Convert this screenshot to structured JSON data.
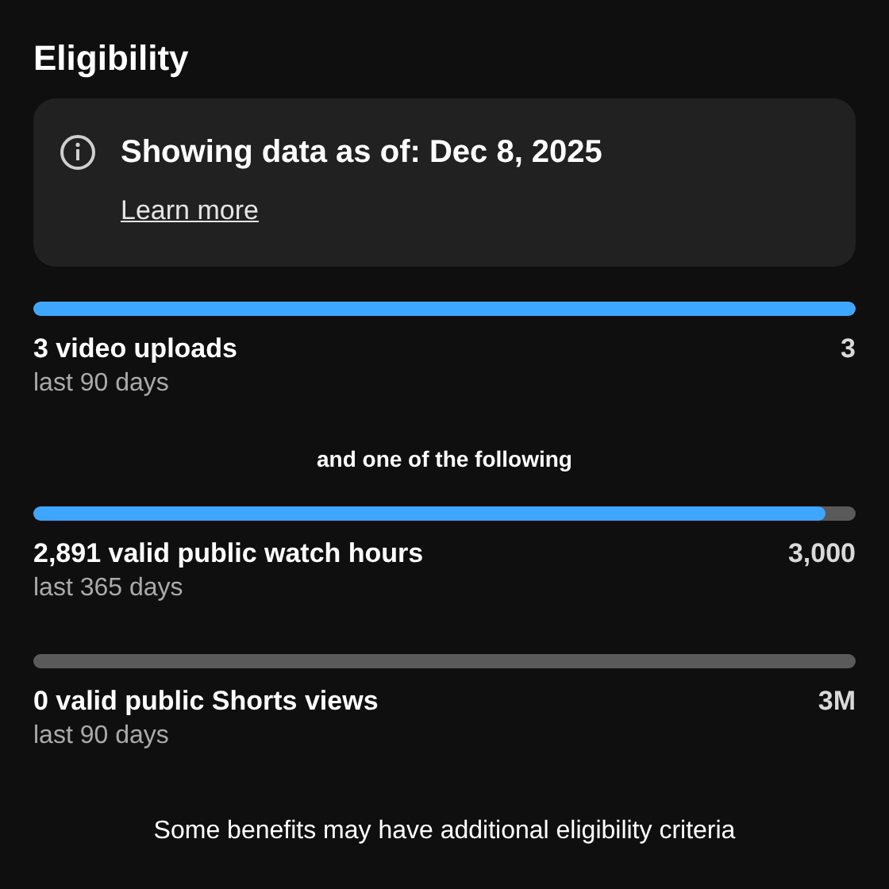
{
  "title": "Eligibility",
  "notice": {
    "text": "Showing data as of: Dec 8, 2025",
    "link": "Learn more"
  },
  "requirements": [
    {
      "label": "3 video uploads",
      "period": "last 90 days",
      "target": "3",
      "level": 1
    }
  ],
  "alternatives_heading": "and one of the following",
  "alternatives": [
    {
      "label": "2,891 valid public watch hours",
      "period": "last 365 days",
      "target": "3,000",
      "level": 0.9637
    },
    {
      "label": "0 valid public Shorts views",
      "period": "last 90 days",
      "target": "3M",
      "level": 0
    }
  ],
  "footer": "Some benefits may have additional eligibility criteria"
}
